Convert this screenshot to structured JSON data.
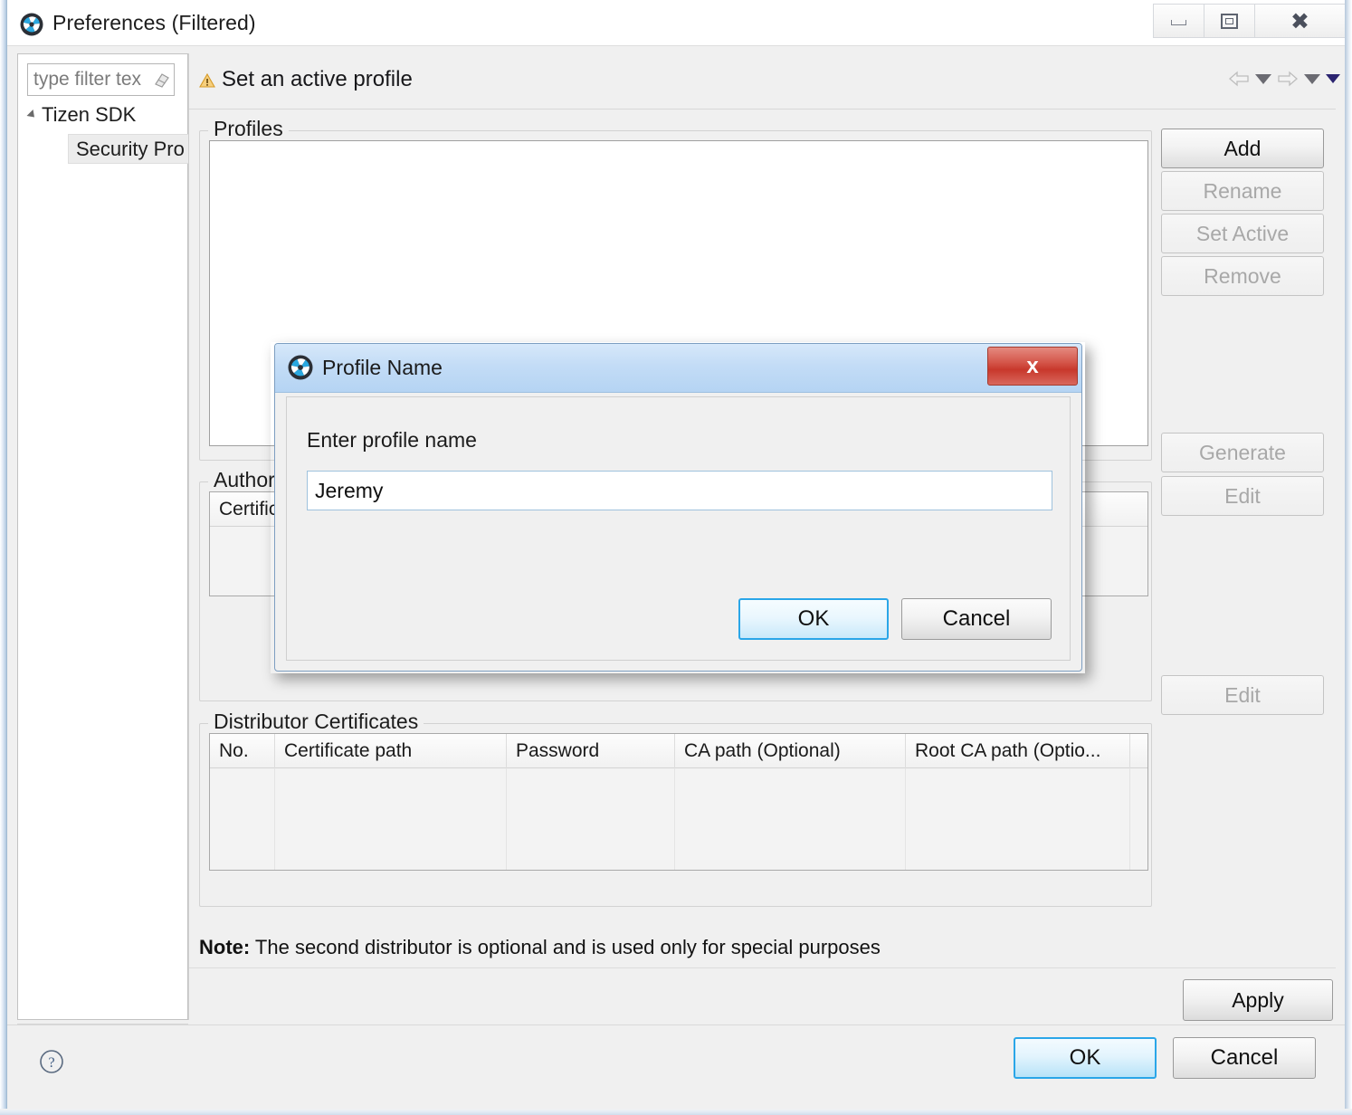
{
  "window": {
    "title": "Preferences (Filtered)",
    "icon": "tizen-logo-icon",
    "controls": {
      "minimize": "minimize-icon",
      "maximize": "maximize-icon",
      "close": "close-icon"
    }
  },
  "sidebar": {
    "filter": {
      "value": "type filter tex",
      "placeholder": "type filter text",
      "clear_icon": "eraser-icon"
    },
    "tree": [
      {
        "label": "Tizen SDK",
        "expanded": true,
        "selected": false
      },
      {
        "label": "Security Pro",
        "expanded": false,
        "selected": true
      }
    ],
    "scrollbar": {
      "left_arrow": "scroll-left-icon",
      "right_arrow": "scroll-right-icon"
    }
  },
  "pane": {
    "header": {
      "warning_icon": "warning-icon",
      "title": "Set an active profile"
    },
    "nav": {
      "back_icon": "arrow-left-icon",
      "back_menu_icon": "chevron-down-icon",
      "forward_icon": "arrow-right-icon",
      "forward_menu_icon": "chevron-down-icon",
      "view_menu_icon": "chevron-down-icon"
    },
    "groups": {
      "profiles": {
        "label": "Profiles",
        "items": [],
        "buttons": [
          {
            "label": "Add",
            "enabled": true
          },
          {
            "label": "Rename",
            "enabled": false
          },
          {
            "label": "Set Active",
            "enabled": false
          },
          {
            "label": "Remove",
            "enabled": false
          }
        ]
      },
      "author": {
        "label": "Author",
        "columns": [
          "Certific"
        ],
        "rows": [],
        "buttons": [
          {
            "label": "Generate",
            "enabled": false
          },
          {
            "label": "Edit",
            "enabled": false
          }
        ]
      },
      "distributor": {
        "label": "Distributor Certificates",
        "columns": [
          "No.",
          "Certificate path",
          "Password",
          "CA path (Optional)",
          "Root CA path (Optio..."
        ],
        "rows": [],
        "buttons": [
          {
            "label": "Edit",
            "enabled": false
          }
        ]
      }
    },
    "note_prefix": "Note:",
    "note_text": " The second distributor is optional and is used only for special purposes",
    "apply_label": "Apply"
  },
  "footer": {
    "help_icon": "help-icon",
    "ok_label": "OK",
    "cancel_label": "Cancel"
  },
  "dialog": {
    "icon": "tizen-logo-icon",
    "title": "Profile Name",
    "close_label": "x",
    "prompt": "Enter profile name",
    "input_value": "Jeremy",
    "input_placeholder": "",
    "ok_label": "OK",
    "cancel_label": "Cancel"
  },
  "colors": {
    "dialog_title_bg": "#c3dcf6",
    "close_button_red": "#c8382c",
    "default_button_border": "#2aa6e8",
    "window_bg": "#f0f0f0",
    "warning_orange": "#f0ad35"
  }
}
